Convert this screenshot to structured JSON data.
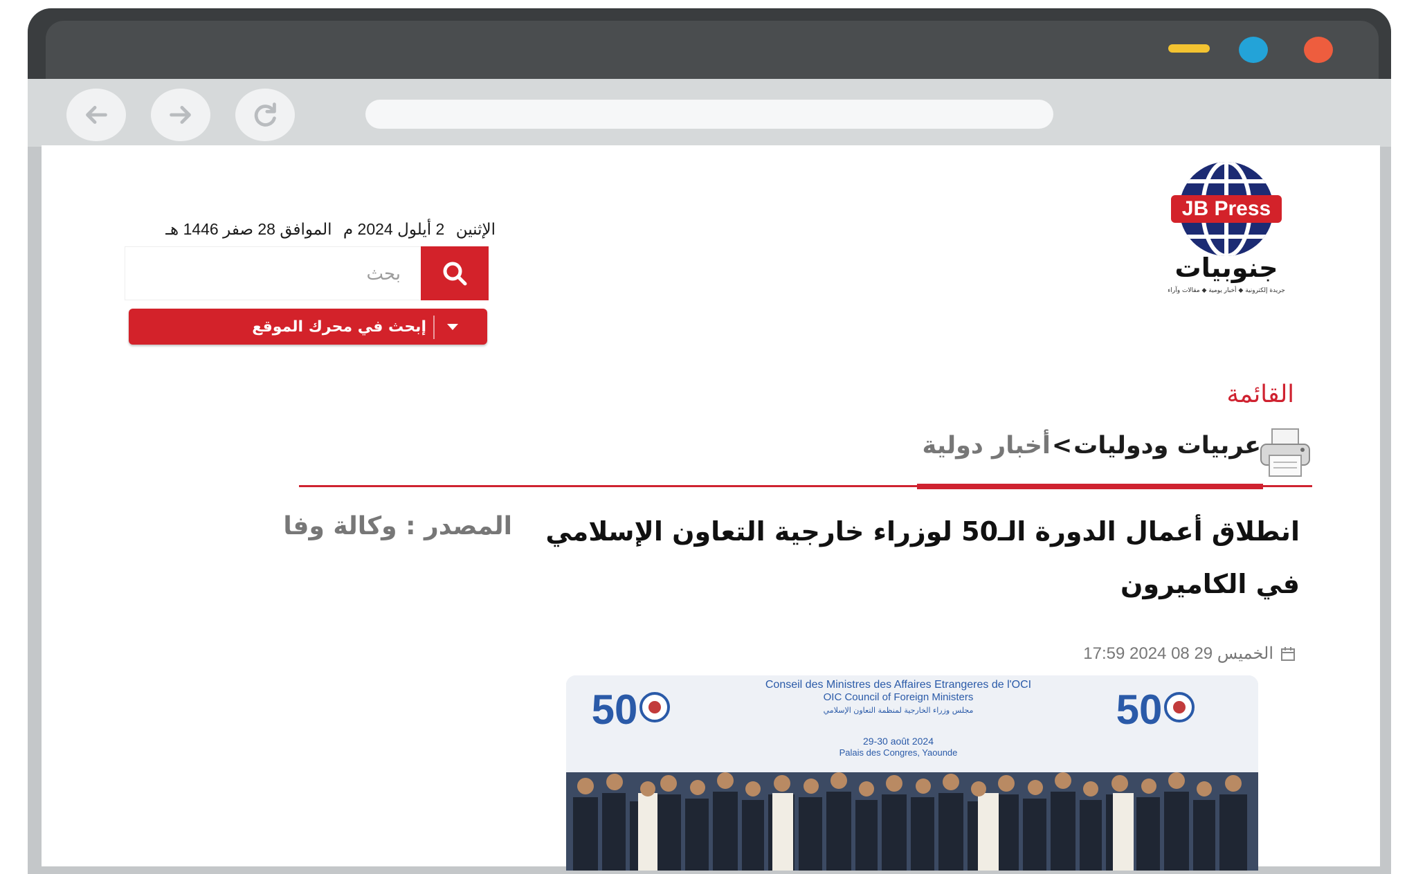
{
  "browser": {
    "window_controls": [
      "minimize",
      "maximize",
      "close"
    ],
    "nav_icons": [
      "back-arrow-icon",
      "forward-arrow-icon",
      "reload-icon"
    ],
    "address": ""
  },
  "header": {
    "logo_brand": "JB Press",
    "logo_arabic": "جنوبيات",
    "logo_tagline": "جريدة إلكترونية ◆ أخبار يومية ◆ مقالات وآراء",
    "date_weekday": "الإثنين",
    "date_gregorian": "2 أيلول 2024 م",
    "date_hijri": "الموافق 28 صفر 1446 هـ"
  },
  "search": {
    "placeholder": "بحث",
    "engine_label": "إبحث في محرك الموقع"
  },
  "menu": {
    "label": "القائمة"
  },
  "breadcrumb": {
    "category": "عربيات ودوليات",
    "separator": ">",
    "subcategory": "أخبار دولية"
  },
  "article": {
    "title": "انطلاق أعمال الدورة الـ50 لوزراء خارجية التعاون الإسلامي في الكاميرون",
    "source": "المصدر : وكالة وفا",
    "date": "الخميس 29 08 2024 17:59",
    "image": {
      "banner_fr": "Conseil des Ministres des Affaires Etrangeres de l'OCI",
      "banner_en": "OIC Council of Foreign Ministers",
      "banner_ar": "مجلس وزراء الخارجية لمنظمة التعاون الإسلامي",
      "banner_dates": "29-30 août 2024",
      "banner_venue": "Palais des Congres, Yaounde",
      "badge_number": "50"
    }
  },
  "colors": {
    "accent_red": "#d3222a",
    "menu_red": "#cf2230",
    "text_dark": "#111111",
    "text_muted": "#777777",
    "frame_gray": "#c4c7c9",
    "titlebar": "#3a3d3f"
  }
}
